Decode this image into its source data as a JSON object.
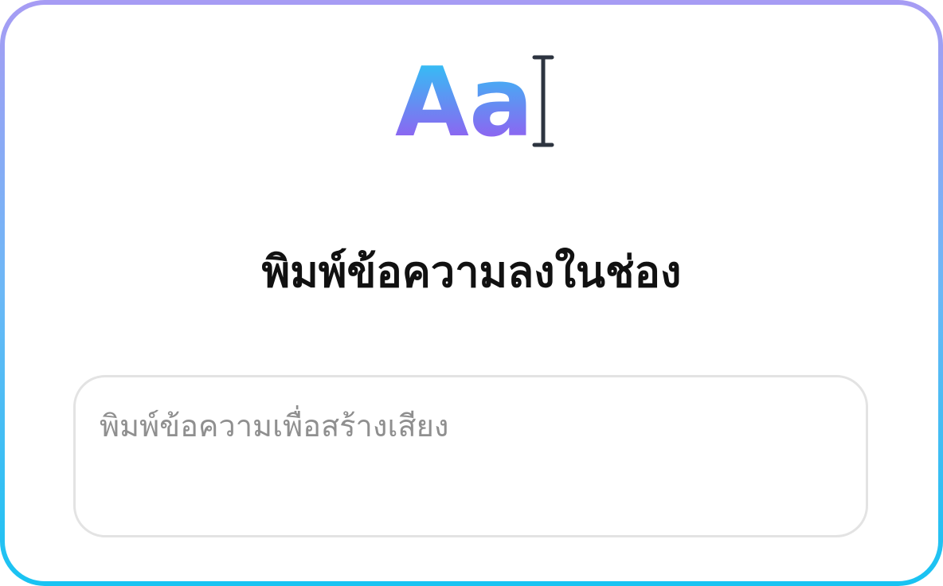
{
  "logo": {
    "text": "Aa",
    "icon": "text-cursor-icon",
    "gradient_start": "#22d0f5",
    "gradient_end": "#a64cf0"
  },
  "heading": {
    "title": "พิมพ์ข้อความลงในช่อง"
  },
  "input": {
    "value": "",
    "placeholder": "พิมพ์ข้อความเพื่อสร้างเสียง"
  },
  "colors": {
    "border_top": "#a79cf4",
    "border_bottom": "#18c3f2",
    "title": "#111111",
    "placeholder": "#8f8f8f"
  }
}
